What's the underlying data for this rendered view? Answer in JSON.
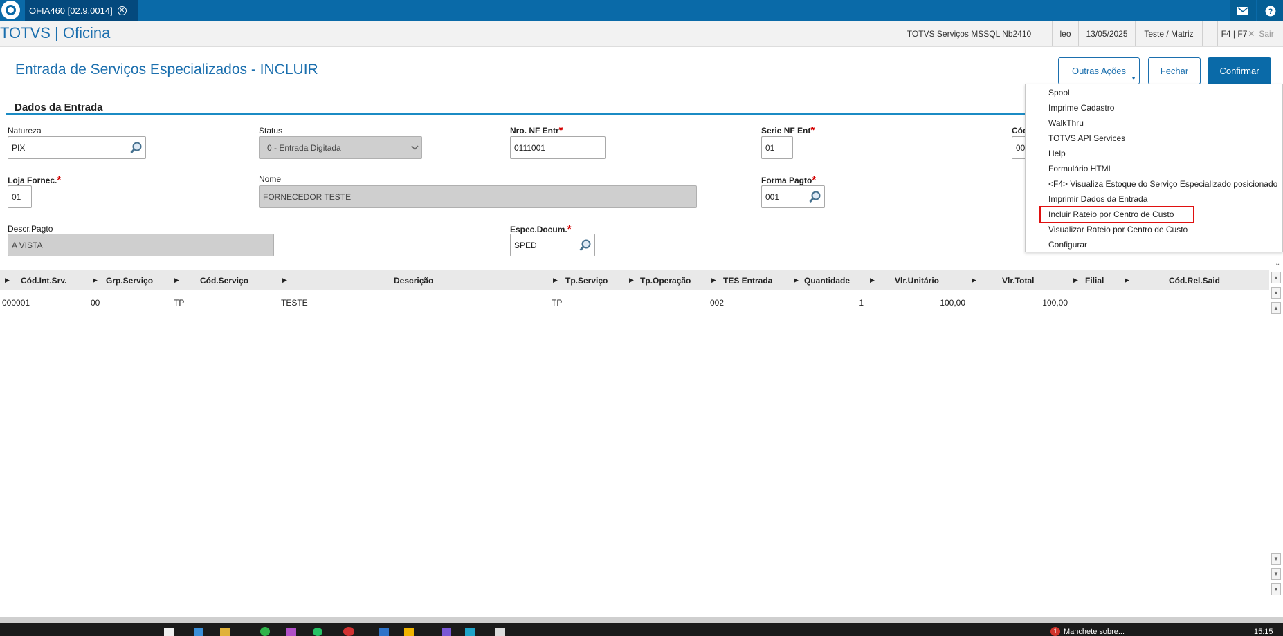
{
  "app": {
    "tab_title": "OFIA460 [02.9.0014]",
    "tab_close": "✕",
    "mail_icon": "envelope-icon",
    "help_icon": "question-icon"
  },
  "header": {
    "brand": "TOTVS | Oficina",
    "environment": "TOTVS Serviços MSSQL Nb2410",
    "user": "leo",
    "date": "13/05/2025",
    "company": "Teste / Matriz",
    "shortcuts": "F4 | F7",
    "exit": "Sair",
    "exit_icon": "✕"
  },
  "page": {
    "title": "Entrada de Serviços Especializados - INCLUIR",
    "buttons": {
      "other_actions": "Outras Ações",
      "close": "Fechar",
      "confirm": "Confirmar"
    }
  },
  "section": {
    "title": "Dados da Entrada"
  },
  "fields": {
    "natureza": {
      "label": "Natureza",
      "value": "PIX"
    },
    "status": {
      "label": "Status",
      "value": "0 - Entrada Digitada"
    },
    "nro_nf": {
      "label": "Nro. NF Entr",
      "value": "0111001"
    },
    "serie_nf": {
      "label": "Serie NF Ent",
      "value": "01"
    },
    "cod_partial": {
      "label": "Cód",
      "value": "00"
    },
    "loja": {
      "label": "Loja Fornec.",
      "value": "01"
    },
    "nome": {
      "label": "Nome",
      "value": "FORNECEDOR TESTE"
    },
    "forma_pagto": {
      "label": "Forma Pagto",
      "value": "001"
    },
    "descr_pagto": {
      "label": "Descr.Pagto",
      "value": "A VISTA"
    },
    "espec_docum": {
      "label": "Espec.Docum.",
      "value": "SPED"
    },
    "required_mark": "*"
  },
  "menu": {
    "items": [
      "Spool",
      "Imprime Cadastro",
      "WalkThru",
      "TOTVS API Services",
      "Help",
      "Formulário HTML",
      "<F4> Visualiza Estoque do Serviço Especializado posicionado",
      "Imprimir Dados da Entrada",
      "Incluir Rateio por Centro de Custo",
      "Visualizar Rateio por Centro de Custo",
      "Configurar"
    ],
    "highlighted_index": 8
  },
  "grid": {
    "columns": [
      "Cód.Int.Srv.",
      "Grp.Serviço",
      "Cód.Serviço",
      "Descrição",
      "Tp.Serviço",
      "Tp.Operação",
      "TES Entrada",
      "Quantidade",
      "Vlr.Unitário",
      "Vlr.Total",
      "Filial",
      "Cód.Rel.Said"
    ],
    "rows": [
      [
        "000001",
        "00",
        "TP",
        "TESTE",
        "TP",
        "",
        "002",
        "1",
        "100,00",
        "100,00",
        "",
        ""
      ]
    ]
  },
  "taskbar": {
    "news_badge": "1",
    "news_text": "Manchete sobre...",
    "clock": "15:15"
  },
  "colors": {
    "brand_blue": "#0a6aa8",
    "highlight_red": "#e01010",
    "required_red": "#d40000"
  }
}
